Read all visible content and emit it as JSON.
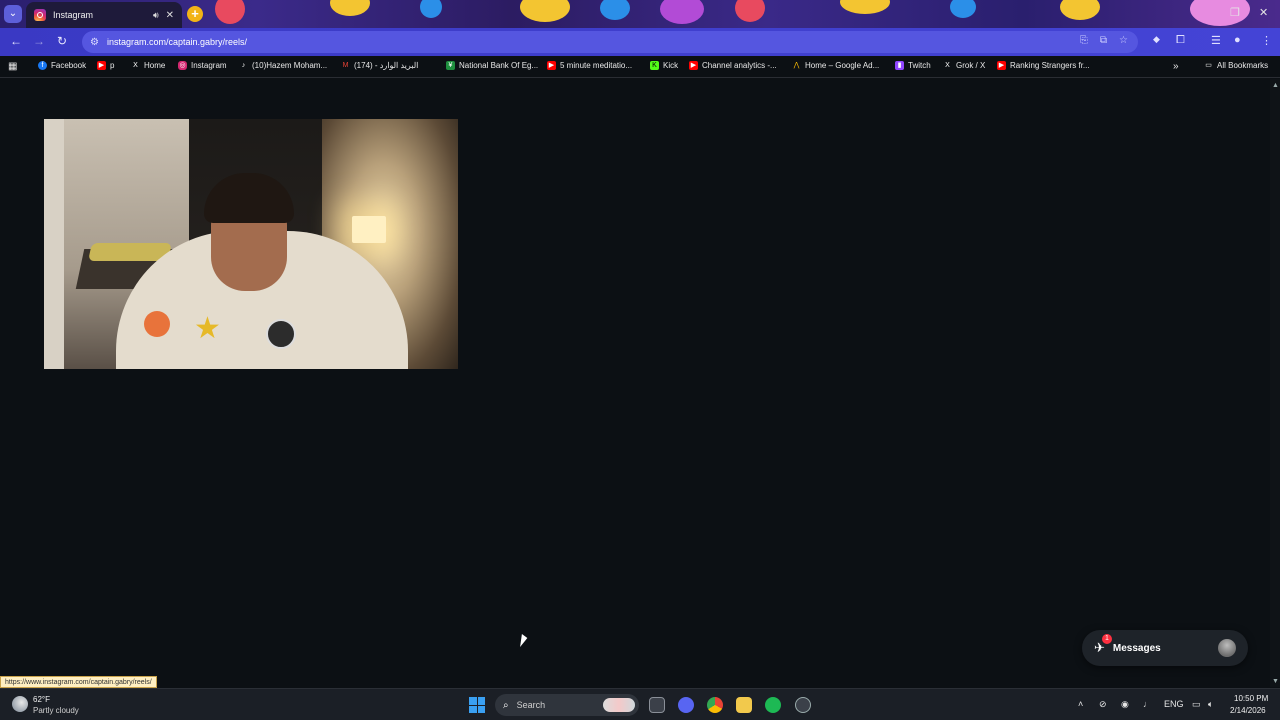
{
  "browser": {
    "tab": {
      "title": "Instagram"
    },
    "address": {
      "url": "instagram.com/captain.gabry/reels/"
    },
    "bookmarks": [
      {
        "label": "Facebook",
        "icon": "facebook-icon",
        "color": "#1877f2"
      },
      {
        "label": "p",
        "icon": "youtube-icon",
        "color": "#ff0000"
      },
      {
        "label": "Home",
        "icon": "x-icon",
        "color": "#ffffff"
      },
      {
        "label": "Instagram",
        "icon": "instagram-icon",
        "color": "#d3276f"
      },
      {
        "label": "(10)Hazem Moham...",
        "icon": "tiktok-icon",
        "color": "#ffffff"
      },
      {
        "label": "البريد الوارد - (174)",
        "icon": "gmail-icon",
        "color": "#ea4335"
      },
      {
        "label": "National Bank Of Eg...",
        "icon": "nbe-icon",
        "color": "#1e8f3e"
      },
      {
        "label": "5 minute meditatio...",
        "icon": "youtube-icon",
        "color": "#ff0000"
      },
      {
        "label": "Kick",
        "icon": "kick-icon",
        "color": "#53fc18"
      },
      {
        "label": "Channel analytics -...",
        "icon": "youtube-icon",
        "color": "#ff0000"
      },
      {
        "label": "Home – Google Ad...",
        "icon": "google-ads-icon",
        "color": "#fbbc04"
      },
      {
        "label": "Twitch",
        "icon": "twitch-icon",
        "color": "#9146ff"
      },
      {
        "label": "Grok / X",
        "icon": "x-icon",
        "color": "#ffffff"
      },
      {
        "label": "Ranking Strangers fr...",
        "icon": "youtube-icon",
        "color": "#ff0000"
      }
    ],
    "all_bookmarks": "All Bookmarks",
    "status_url": "https://www.instagram.com/captain.gabry/reels/"
  },
  "page": {
    "messages_label": "Messages",
    "messages_badge": "1"
  },
  "taskbar": {
    "weather_temp": "62°F",
    "weather_desc": "Partly cloudy",
    "search_placeholder": "Search",
    "language": "ENG",
    "time": "10:50 PM",
    "date": "2/14/2026"
  }
}
